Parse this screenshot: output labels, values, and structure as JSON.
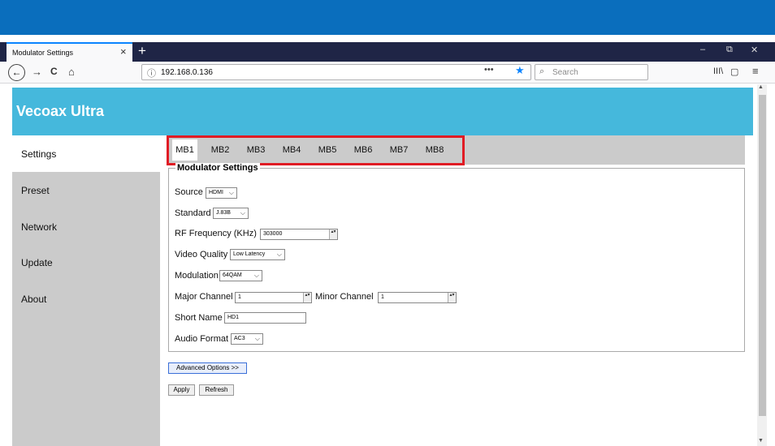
{
  "browser": {
    "tab_title": "Modulator Settings",
    "tab_close": "×",
    "new_tab": "+",
    "window_controls": {
      "minimize": "–",
      "restore": "⧉",
      "close": "✕"
    },
    "nav": {
      "back": "←",
      "forward": "→",
      "reload": "C",
      "home": "⌂"
    },
    "url_info": "ⓘ",
    "url": "192.168.0.136",
    "url_actions": "•••",
    "bookmark_star": "★",
    "search_icon": "⌕",
    "search_placeholder": "Search",
    "toolbar_icons": {
      "library": "III\\",
      "sidebar": "▢",
      "menu": "≡"
    }
  },
  "app": {
    "title": "Vecoax Ultra"
  },
  "sidebar": {
    "items": [
      {
        "label": "Settings",
        "active": true
      },
      {
        "label": "Preset",
        "active": false
      },
      {
        "label": "Network",
        "active": false
      },
      {
        "label": "Update",
        "active": false
      },
      {
        "label": "About",
        "active": false
      }
    ]
  },
  "tabs": [
    {
      "label": "MB1",
      "active": true
    },
    {
      "label": "MB2",
      "active": false
    },
    {
      "label": "MB3",
      "active": false
    },
    {
      "label": "MB4",
      "active": false
    },
    {
      "label": "MB5",
      "active": false
    },
    {
      "label": "MB6",
      "active": false
    },
    {
      "label": "MB7",
      "active": false
    },
    {
      "label": "MB8",
      "active": false
    }
  ],
  "form": {
    "legend": "Modulator Settings",
    "source": {
      "label": "Source",
      "value": "HDMI"
    },
    "standard": {
      "label": "Standard",
      "value": "J.83B"
    },
    "rf_frequency": {
      "label": "RF Frequency (KHz)",
      "value": "303000"
    },
    "video_quality": {
      "label": "Video Quality",
      "value": "Low Latency"
    },
    "modulation": {
      "label": "Modulation",
      "value": "64QAM"
    },
    "major_channel": {
      "label": "Major Channel",
      "value": "1"
    },
    "minor_channel": {
      "label": "Minor Channel",
      "value": "1"
    },
    "short_name": {
      "label": "Short Name",
      "value": "HD1"
    },
    "audio_format": {
      "label": "Audio Format",
      "value": "AC3"
    }
  },
  "buttons": {
    "advanced": "Advanced Options >>",
    "apply": "Apply",
    "refresh": "Refresh"
  },
  "symbols": {
    "dropdown": "⌵",
    "spin": "▴▾",
    "scroll_up": "▲",
    "scroll_down": "▼"
  },
  "colors": {
    "header": "#45b8dc",
    "top_band": "#0a6ebd",
    "sidebar": "#cbcbcb",
    "highlight": "#e01b24"
  }
}
